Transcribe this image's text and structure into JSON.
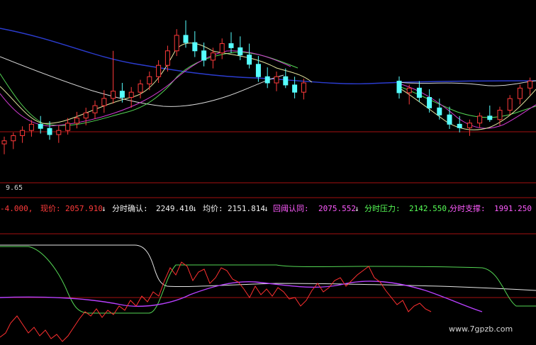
{
  "chart_data": [
    {
      "type": "candlestick",
      "title": "",
      "price_axis_label": "9.65",
      "candles_segment_1": [
        {
          "o": 2010,
          "h": 2024,
          "l": 1990,
          "c": 2016
        },
        {
          "o": 2016,
          "h": 2032,
          "l": 2000,
          "c": 2026
        },
        {
          "o": 2026,
          "h": 2044,
          "l": 2012,
          "c": 2036
        },
        {
          "o": 2036,
          "h": 2056,
          "l": 2024,
          "c": 2048
        },
        {
          "o": 2048,
          "h": 2064,
          "l": 2030,
          "c": 2040
        },
        {
          "o": 2040,
          "h": 2054,
          "l": 2018,
          "c": 2028
        },
        {
          "o": 2028,
          "h": 2046,
          "l": 2012,
          "c": 2036
        },
        {
          "o": 2036,
          "h": 2060,
          "l": 2028,
          "c": 2050
        },
        {
          "o": 2050,
          "h": 2072,
          "l": 2040,
          "c": 2060
        },
        {
          "o": 2060,
          "h": 2080,
          "l": 2046,
          "c": 2070
        },
        {
          "o": 2070,
          "h": 2094,
          "l": 2058,
          "c": 2084
        },
        {
          "o": 2084,
          "h": 2114,
          "l": 2070,
          "c": 2098
        },
        {
          "o": 2098,
          "h": 2190,
          "l": 2088,
          "c": 2112
        },
        {
          "o": 2112,
          "h": 2128,
          "l": 2090,
          "c": 2100
        },
        {
          "o": 2100,
          "h": 2120,
          "l": 2080,
          "c": 2110
        },
        {
          "o": 2110,
          "h": 2134,
          "l": 2098,
          "c": 2126
        },
        {
          "o": 2126,
          "h": 2150,
          "l": 2114,
          "c": 2140
        },
        {
          "o": 2140,
          "h": 2172,
          "l": 2128,
          "c": 2162
        },
        {
          "o": 2162,
          "h": 2200,
          "l": 2150,
          "c": 2190
        },
        {
          "o": 2190,
          "h": 2232,
          "l": 2180,
          "c": 2220
        },
        {
          "o": 2220,
          "h": 2249,
          "l": 2196,
          "c": 2206
        },
        {
          "o": 2206,
          "h": 2228,
          "l": 2178,
          "c": 2190
        },
        {
          "o": 2190,
          "h": 2206,
          "l": 2160,
          "c": 2172
        },
        {
          "o": 2172,
          "h": 2196,
          "l": 2156,
          "c": 2186
        },
        {
          "o": 2186,
          "h": 2214,
          "l": 2174,
          "c": 2204
        },
        {
          "o": 2204,
          "h": 2226,
          "l": 2186,
          "c": 2196
        },
        {
          "o": 2196,
          "h": 2218,
          "l": 2172,
          "c": 2182
        },
        {
          "o": 2182,
          "h": 2204,
          "l": 2156,
          "c": 2164
        },
        {
          "o": 2164,
          "h": 2180,
          "l": 2130,
          "c": 2140
        },
        {
          "o": 2140,
          "h": 2158,
          "l": 2118,
          "c": 2128
        },
        {
          "o": 2128,
          "h": 2150,
          "l": 2112,
          "c": 2140
        },
        {
          "o": 2140,
          "h": 2156,
          "l": 2118,
          "c": 2124
        },
        {
          "o": 2124,
          "h": 2140,
          "l": 2098,
          "c": 2110
        },
        {
          "o": 2110,
          "h": 2136,
          "l": 2096,
          "c": 2128
        }
      ],
      "candles_segment_2": [
        {
          "o": 2140,
          "h": 2148,
          "l": 2110,
          "c": 2120
        },
        {
          "o": 2120,
          "h": 2134,
          "l": 2100,
          "c": 2128
        },
        {
          "o": 2128,
          "h": 2140,
          "l": 2104,
          "c": 2112
        },
        {
          "o": 2112,
          "h": 2126,
          "l": 2086,
          "c": 2094
        },
        {
          "o": 2094,
          "h": 2110,
          "l": 2074,
          "c": 2082
        },
        {
          "o": 2082,
          "h": 2096,
          "l": 2058,
          "c": 2066
        },
        {
          "o": 2066,
          "h": 2080,
          "l": 2052,
          "c": 2060
        },
        {
          "o": 2060,
          "h": 2074,
          "l": 2046,
          "c": 2068
        },
        {
          "o": 2068,
          "h": 2086,
          "l": 2060,
          "c": 2080
        },
        {
          "o": 2080,
          "h": 2098,
          "l": 2070,
          "c": 2074
        },
        {
          "o": 2074,
          "h": 2096,
          "l": 2064,
          "c": 2090
        },
        {
          "o": 2090,
          "h": 2116,
          "l": 2082,
          "c": 2110
        },
        {
          "o": 2110,
          "h": 2134,
          "l": 2100,
          "c": 2128
        },
        {
          "o": 2128,
          "h": 2146,
          "l": 2116,
          "c": 2140
        }
      ],
      "info_bar": {
        "lead_value": "-4.000,",
        "items": [
          {
            "label": "现价:",
            "value": "2057.910",
            "arrow": "↓",
            "color": "#ff3b3b"
          },
          {
            "label": "分时确认:",
            "value": "2249.410",
            "arrow": "↓",
            "color": "#f2f2f2"
          },
          {
            "label": "均价:",
            "value": "2151.814",
            "arrow": "↓",
            "color": "#f2f2f2"
          },
          {
            "label": "回阈认同:",
            "value": "2075.552",
            "arrow": "↓",
            "color": "#ff5bff"
          },
          {
            "label": "分时压力:",
            "value": "2142.550,",
            "arrow": "",
            "color": "#57ff57"
          },
          {
            "label": "分时支撑:",
            "value": "1991.250",
            "arrow": "",
            "color": "#ff5bff"
          }
        ]
      },
      "watermark": "www.7gpzb.com",
      "colors": {
        "background": "#000000",
        "grid_red": "#a31111",
        "bull": "#ff3a3a",
        "bear": "#56ffff",
        "ma_blue": "#2b3ccf",
        "ma_white": "#d8d8d8",
        "ma_green": "#54d654",
        "ma_magenta": "#d23ad2",
        "ma_yellow": "#e6e6a0"
      }
    }
  ]
}
